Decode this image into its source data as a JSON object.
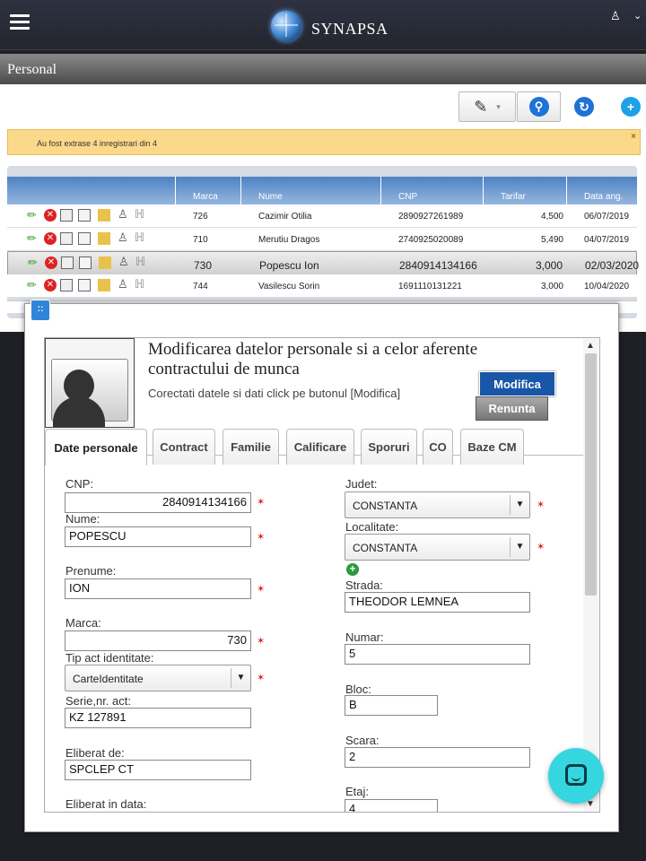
{
  "header": {
    "brand": "SYNAPSA"
  },
  "section": {
    "title": "Personal"
  },
  "alert": {
    "message": "Au fost extrase 4 inregistrari din 4",
    "close": "×"
  },
  "grid": {
    "columns": [
      "Marca",
      "Nume",
      "CNP",
      "Tarifar",
      "Data ang."
    ],
    "rows": [
      {
        "marca": "726",
        "nume": "Cazimir Otilia",
        "cnp": "2890927261989",
        "tarifar": "4,500",
        "data": "06/07/2019"
      },
      {
        "marca": "710",
        "nume": "Merutiu Dragos",
        "cnp": "2740925020089",
        "tarifar": "5,490",
        "data": "04/07/2019"
      },
      {
        "marca": "730",
        "nume": "Popescu Ion",
        "cnp": "2840914134166",
        "tarifar": "3,000",
        "data": "02/03/2020"
      },
      {
        "marca": "744",
        "nume": "Vasilescu Sorin",
        "cnp": "1691110131221",
        "tarifar": "3,000",
        "data": "10/04/2020"
      }
    ]
  },
  "form": {
    "title": "Modificarea datelor personale si a celor aferente contractului de munca",
    "subtitle": "Corectati datele si dati click pe butonul [Modifica]",
    "btn_modifica": "Modifica",
    "btn_renunta": "Renunta",
    "tabs": [
      "Date personale",
      "Contract",
      "Familie",
      "Calificare",
      "Sporuri",
      "CO",
      "Baze CM"
    ],
    "labels": {
      "cnp": "CNP:",
      "nume": "Nume:",
      "prenume": "Prenume:",
      "marca": "Marca:",
      "tip_act": "Tip act identitate:",
      "serie": "Serie,nr. act:",
      "eliberat_de": "Eliberat de:",
      "eliberat_data": "Eliberat in data:",
      "judet": "Judet:",
      "localitate": "Localitate:",
      "strada": "Strada:",
      "numar": "Numar:",
      "bloc": "Bloc:",
      "scara": "Scara:",
      "etaj": "Etaj:"
    },
    "values": {
      "cnp": "2840914134166",
      "nume": "POPESCU",
      "prenume": "ION",
      "marca": "730",
      "tip_act": "CarteIdentitate",
      "serie": "KZ 127891",
      "eliberat_de": "SPCLEP CT",
      "judet": "CONSTANTA",
      "localitate": "CONSTANTA",
      "strada": "THEODOR LEMNEA",
      "numar": "5",
      "bloc": "B",
      "scara": "2",
      "etaj": "4"
    }
  }
}
